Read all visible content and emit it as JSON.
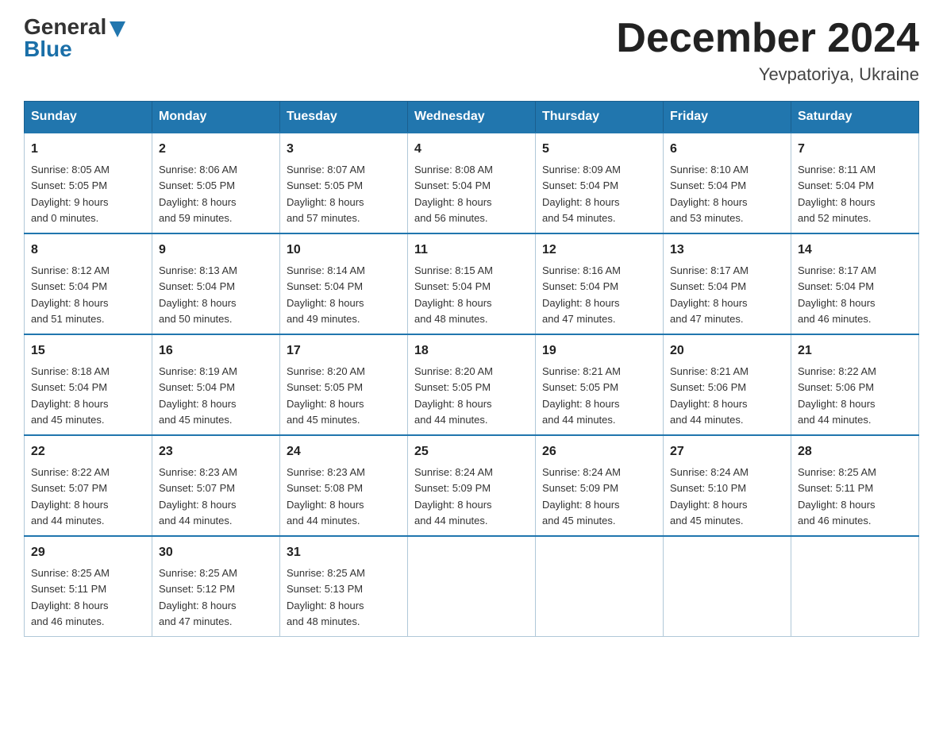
{
  "header": {
    "logo_general": "General",
    "logo_blue": "Blue",
    "month_title": "December 2024",
    "location": "Yevpatoriya, Ukraine"
  },
  "days_of_week": [
    "Sunday",
    "Monday",
    "Tuesday",
    "Wednesday",
    "Thursday",
    "Friday",
    "Saturday"
  ],
  "weeks": [
    [
      {
        "day": "1",
        "sunrise": "8:05 AM",
        "sunset": "5:05 PM",
        "daylight": "9 hours",
        "daylight2": "and 0 minutes."
      },
      {
        "day": "2",
        "sunrise": "8:06 AM",
        "sunset": "5:05 PM",
        "daylight": "8 hours",
        "daylight2": "and 59 minutes."
      },
      {
        "day": "3",
        "sunrise": "8:07 AM",
        "sunset": "5:05 PM",
        "daylight": "8 hours",
        "daylight2": "and 57 minutes."
      },
      {
        "day": "4",
        "sunrise": "8:08 AM",
        "sunset": "5:04 PM",
        "daylight": "8 hours",
        "daylight2": "and 56 minutes."
      },
      {
        "day": "5",
        "sunrise": "8:09 AM",
        "sunset": "5:04 PM",
        "daylight": "8 hours",
        "daylight2": "and 54 minutes."
      },
      {
        "day": "6",
        "sunrise": "8:10 AM",
        "sunset": "5:04 PM",
        "daylight": "8 hours",
        "daylight2": "and 53 minutes."
      },
      {
        "day": "7",
        "sunrise": "8:11 AM",
        "sunset": "5:04 PM",
        "daylight": "8 hours",
        "daylight2": "and 52 minutes."
      }
    ],
    [
      {
        "day": "8",
        "sunrise": "8:12 AM",
        "sunset": "5:04 PM",
        "daylight": "8 hours",
        "daylight2": "and 51 minutes."
      },
      {
        "day": "9",
        "sunrise": "8:13 AM",
        "sunset": "5:04 PM",
        "daylight": "8 hours",
        "daylight2": "and 50 minutes."
      },
      {
        "day": "10",
        "sunrise": "8:14 AM",
        "sunset": "5:04 PM",
        "daylight": "8 hours",
        "daylight2": "and 49 minutes."
      },
      {
        "day": "11",
        "sunrise": "8:15 AM",
        "sunset": "5:04 PM",
        "daylight": "8 hours",
        "daylight2": "and 48 minutes."
      },
      {
        "day": "12",
        "sunrise": "8:16 AM",
        "sunset": "5:04 PM",
        "daylight": "8 hours",
        "daylight2": "and 47 minutes."
      },
      {
        "day": "13",
        "sunrise": "8:17 AM",
        "sunset": "5:04 PM",
        "daylight": "8 hours",
        "daylight2": "and 47 minutes."
      },
      {
        "day": "14",
        "sunrise": "8:17 AM",
        "sunset": "5:04 PM",
        "daylight": "8 hours",
        "daylight2": "and 46 minutes."
      }
    ],
    [
      {
        "day": "15",
        "sunrise": "8:18 AM",
        "sunset": "5:04 PM",
        "daylight": "8 hours",
        "daylight2": "and 45 minutes."
      },
      {
        "day": "16",
        "sunrise": "8:19 AM",
        "sunset": "5:04 PM",
        "daylight": "8 hours",
        "daylight2": "and 45 minutes."
      },
      {
        "day": "17",
        "sunrise": "8:20 AM",
        "sunset": "5:05 PM",
        "daylight": "8 hours",
        "daylight2": "and 45 minutes."
      },
      {
        "day": "18",
        "sunrise": "8:20 AM",
        "sunset": "5:05 PM",
        "daylight": "8 hours",
        "daylight2": "and 44 minutes."
      },
      {
        "day": "19",
        "sunrise": "8:21 AM",
        "sunset": "5:05 PM",
        "daylight": "8 hours",
        "daylight2": "and 44 minutes."
      },
      {
        "day": "20",
        "sunrise": "8:21 AM",
        "sunset": "5:06 PM",
        "daylight": "8 hours",
        "daylight2": "and 44 minutes."
      },
      {
        "day": "21",
        "sunrise": "8:22 AM",
        "sunset": "5:06 PM",
        "daylight": "8 hours",
        "daylight2": "and 44 minutes."
      }
    ],
    [
      {
        "day": "22",
        "sunrise": "8:22 AM",
        "sunset": "5:07 PM",
        "daylight": "8 hours",
        "daylight2": "and 44 minutes."
      },
      {
        "day": "23",
        "sunrise": "8:23 AM",
        "sunset": "5:07 PM",
        "daylight": "8 hours",
        "daylight2": "and 44 minutes."
      },
      {
        "day": "24",
        "sunrise": "8:23 AM",
        "sunset": "5:08 PM",
        "daylight": "8 hours",
        "daylight2": "and 44 minutes."
      },
      {
        "day": "25",
        "sunrise": "8:24 AM",
        "sunset": "5:09 PM",
        "daylight": "8 hours",
        "daylight2": "and 44 minutes."
      },
      {
        "day": "26",
        "sunrise": "8:24 AM",
        "sunset": "5:09 PM",
        "daylight": "8 hours",
        "daylight2": "and 45 minutes."
      },
      {
        "day": "27",
        "sunrise": "8:24 AM",
        "sunset": "5:10 PM",
        "daylight": "8 hours",
        "daylight2": "and 45 minutes."
      },
      {
        "day": "28",
        "sunrise": "8:25 AM",
        "sunset": "5:11 PM",
        "daylight": "8 hours",
        "daylight2": "and 46 minutes."
      }
    ],
    [
      {
        "day": "29",
        "sunrise": "8:25 AM",
        "sunset": "5:11 PM",
        "daylight": "8 hours",
        "daylight2": "and 46 minutes."
      },
      {
        "day": "30",
        "sunrise": "8:25 AM",
        "sunset": "5:12 PM",
        "daylight": "8 hours",
        "daylight2": "and 47 minutes."
      },
      {
        "day": "31",
        "sunrise": "8:25 AM",
        "sunset": "5:13 PM",
        "daylight": "8 hours",
        "daylight2": "and 48 minutes."
      },
      null,
      null,
      null,
      null
    ]
  ]
}
